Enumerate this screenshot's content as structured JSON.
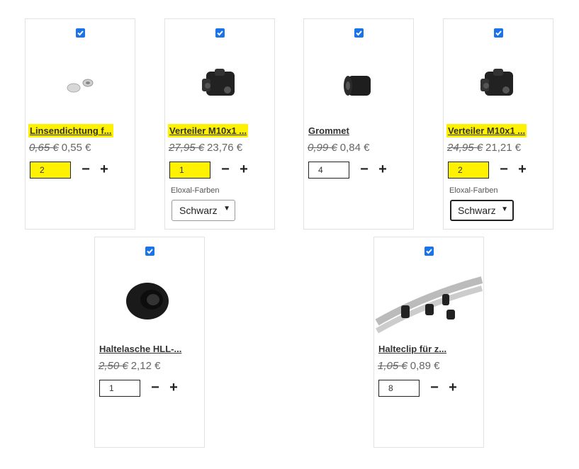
{
  "products": [
    {
      "title": "Linsendichtung f...",
      "old_price": "0,65 €",
      "new_price": "0,55 €",
      "qty": "2",
      "highlight": true,
      "qty_highlight": true,
      "variant_label": null,
      "variant_value": null,
      "image": "lens-seal-icon"
    },
    {
      "title": "Verteiler M10x1 ...",
      "old_price": "27,95 €",
      "new_price": "23,76 €",
      "qty": "1",
      "highlight": true,
      "qty_highlight": true,
      "variant_label": "Eloxal-Farben",
      "variant_value": "Schwarz",
      "image": "distributor-icon"
    },
    {
      "title": "Grommet",
      "old_price": "0,99 €",
      "new_price": "0,84 €",
      "qty": "4",
      "highlight": false,
      "qty_highlight": false,
      "variant_label": null,
      "variant_value": null,
      "image": "grommet-icon"
    },
    {
      "title": "Verteiler M10x1 ...",
      "old_price": "24,95 €",
      "new_price": "21,21 €",
      "qty": "2",
      "highlight": true,
      "qty_highlight": true,
      "variant_label": "Eloxal-Farben",
      "variant_value": "Schwarz",
      "image": "distributor-icon"
    },
    {
      "title": "Haltelasche HLL-...",
      "old_price": "2,50 €",
      "new_price": "2,12 €",
      "qty": "1",
      "highlight": false,
      "qty_highlight": false,
      "variant_label": null,
      "variant_value": null,
      "image": "holding-tab-icon"
    },
    {
      "title": "Halteclip für z...",
      "old_price": "1,05 €",
      "new_price": "0,89 €",
      "qty": "8",
      "highlight": false,
      "qty_highlight": false,
      "variant_label": null,
      "variant_value": null,
      "image": "tube-clip-icon"
    }
  ],
  "controls": {
    "minus": "−",
    "plus": "+",
    "chevron": "⌄"
  },
  "colors": {
    "highlight": "#fff200",
    "checkbox": "#1a73e8"
  }
}
